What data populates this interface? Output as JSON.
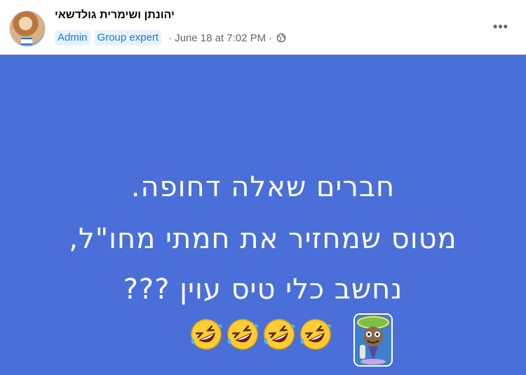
{
  "post": {
    "author": "יהונתן ושימרית גולדשאי",
    "badges": [
      "Admin",
      "Group expert"
    ],
    "timestamp": "June 18 at 7:02 PM",
    "privacy_icon": "globe-icon",
    "more_icon": "more-options-icon",
    "more_label": "•••"
  },
  "content": {
    "background_color": "#4a6fd8",
    "lines": [
      "חברים שאלה דחופה.",
      "מטוס שמחזיר את חמתי מחו\"ל,",
      "נחשב כלי טיס עוין ???"
    ],
    "emoji_name": "rolling-on-floor-laughing-emoji",
    "emoji_count": 4,
    "sticker_name": "cartoon-character-sticker"
  }
}
